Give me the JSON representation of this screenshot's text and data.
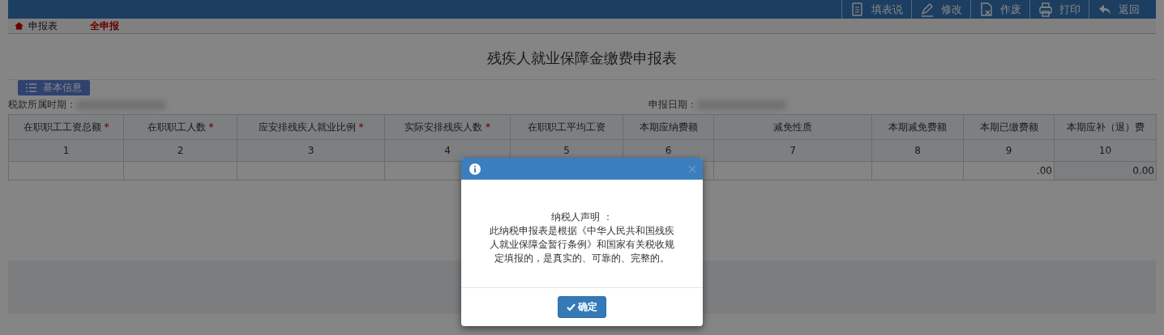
{
  "toolbar": [
    {
      "kind": "doc",
      "label": "填表说"
    },
    {
      "kind": "pen",
      "label": "修改"
    },
    {
      "kind": "void",
      "label": "作废"
    },
    {
      "kind": "print",
      "label": "打印"
    },
    {
      "kind": "back",
      "label": "返回"
    }
  ],
  "tabs": [
    {
      "label": "申报表",
      "selected": false
    },
    {
      "label": "全申报",
      "selected": true
    }
  ],
  "title": "残疾人就业保障金缴费申报表",
  "section": "基本信息",
  "fields": [
    {
      "label": "税款所属时期："
    },
    {
      "label": "申报日期："
    }
  ],
  "table": {
    "columns": [
      {
        "label": "在职职工工资总额",
        "mark": "*",
        "number": "1"
      },
      {
        "label": "在职职工人数",
        "mark": "*",
        "number": "2"
      },
      {
        "label": "应安排残疾人就业比例",
        "mark": "*",
        "number": "3"
      },
      {
        "label": "实际安排残疾人数",
        "mark": "*",
        "number": "4"
      },
      {
        "label": "在职职工平均工资",
        "number": "5"
      },
      {
        "label": "本期应纳费额",
        "number": "6"
      },
      {
        "label": "减免性质",
        "number": "7"
      },
      {
        "label": "本期减免费额",
        "number": "8"
      },
      {
        "label": "本期已缴费额",
        "number": "9",
        "value": ".00"
      },
      {
        "label": "本期应补（退）费",
        "number": "10",
        "value": "0.00"
      }
    ]
  },
  "dialog": {
    "heading": "纳税人声明 ：",
    "body": "此纳税申报表是根据《中华人民共和国残疾人就业保障金暂行条例》和国家有关税收规定填报的，是真实的、可靠的、完整的。",
    "button": "确定"
  }
}
